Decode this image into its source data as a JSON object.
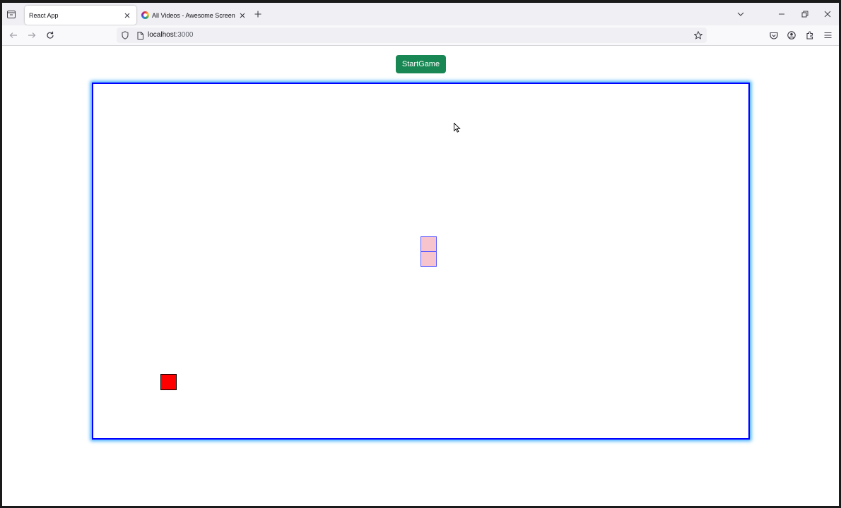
{
  "browser": {
    "tabs": [
      {
        "title": "React App",
        "active": true
      },
      {
        "title": "All Videos - Awesome Screensh",
        "active": false
      }
    ],
    "url": {
      "host": "localhost",
      "port": ":3000"
    },
    "icons": {
      "tab_list": "tab-list-icon",
      "new_tab": "plus-icon",
      "back": "back-arrow-icon",
      "forward": "forward-arrow-icon",
      "reload": "reload-icon",
      "shield": "shield-icon",
      "page": "page-icon",
      "bookmark": "star-icon",
      "pocket": "pocket-icon",
      "account": "account-icon",
      "extensions": "extensions-icon",
      "menu": "hamburger-menu-icon"
    }
  },
  "game": {
    "start_label": "StartGame",
    "colors": {
      "button": "#198754",
      "board_border": "#0000ff",
      "board_glow": "#33a8ff",
      "snake_fill": "#f7c3cc",
      "snake_border": "#5a5aff",
      "food": "#ff0000"
    },
    "snake_segment_count": 2
  }
}
